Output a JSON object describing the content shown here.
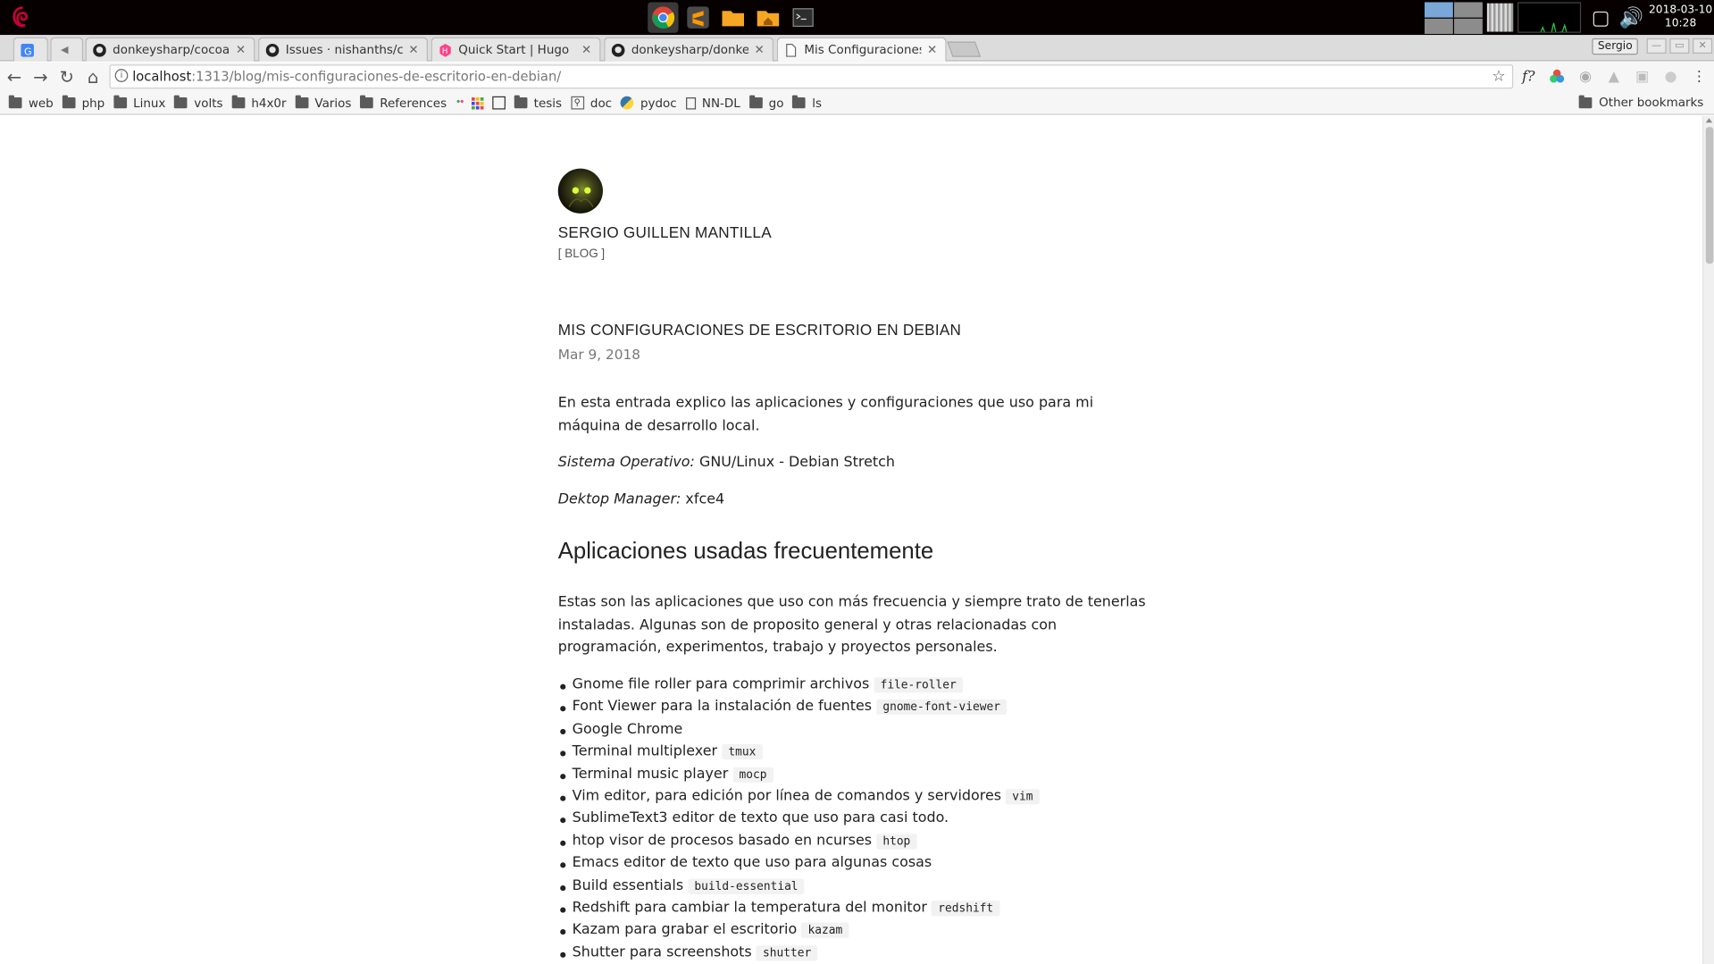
{
  "panel": {
    "clock_date": "2018-03-10",
    "clock_time": "10:28"
  },
  "tabs": [
    {
      "title": "",
      "icon": "google-translate-icon"
    },
    {
      "title": "",
      "icon": "audio-icon"
    },
    {
      "title": "donkeysharp/cocoa-",
      "icon": "github-icon"
    },
    {
      "title": "Issues · nishanths/c",
      "icon": "github-icon"
    },
    {
      "title": "Quick Start | Hugo",
      "icon": "hugo-icon"
    },
    {
      "title": "donkeysharp/donke",
      "icon": "github-icon"
    },
    {
      "title": "Mis Configuraciones",
      "icon": "page-icon"
    }
  ],
  "profile_name": "Sergio",
  "address": {
    "host": "localhost",
    "path": ":1313/blog/mis-configuraciones-de-escritorio-en-debian/"
  },
  "bookmarks": [
    {
      "label": "web",
      "icon": "folder-icon"
    },
    {
      "label": "php",
      "icon": "folder-icon"
    },
    {
      "label": "Linux",
      "icon": "folder-icon"
    },
    {
      "label": "volts",
      "icon": "folder-icon"
    },
    {
      "label": "h4x0r",
      "icon": "folder-icon"
    },
    {
      "label": "Varios",
      "icon": "folder-icon"
    },
    {
      "label": "References",
      "icon": "folder-icon"
    },
    {
      "label": "tesis",
      "icon": "folder-icon"
    },
    {
      "label": "doc",
      "icon": "search-doc-icon"
    },
    {
      "label": "pydoc",
      "icon": "python-icon"
    },
    {
      "label": "NN-DL",
      "icon": "page-icon"
    },
    {
      "label": "go",
      "icon": "folder-icon"
    },
    {
      "label": "ls",
      "icon": "folder-icon"
    }
  ],
  "other_bookmarks": "Other bookmarks",
  "blog": {
    "author": "SERGIO GUILLEN MANTILLA",
    "tag": "[ BLOG ]",
    "post_title": "MIS CONFIGURACIONES DE ESCRITORIO EN DEBIAN",
    "post_date": "Mar 9, 2018",
    "intro": "En esta entrada explico las aplicaciones y configuraciones que uso para mi máquina de desarrollo local.",
    "os_label": "Sistema Operativo:",
    "os_value": " GNU/Linux - Debian Stretch",
    "dm_label": "Dektop Manager:",
    "dm_value": " xfce4",
    "section_title": "Aplicaciones usadas frecuentemente",
    "section_intro": "Estas son las aplicaciones que uso con más frecuencia y siempre trato de tenerlas instaladas. Algunas son de proposito general y otras relacionadas con programación, experimentos, trabajo y proyectos personales.",
    "apps": [
      {
        "text": "Gnome file roller para comprimir archivos",
        "code": "file-roller"
      },
      {
        "text": "Font Viewer para la instalación de fuentes",
        "code": "gnome-font-viewer"
      },
      {
        "text": "Google Chrome",
        "code": ""
      },
      {
        "text": "Terminal multiplexer",
        "code": "tmux"
      },
      {
        "text": "Terminal music player",
        "code": "mocp"
      },
      {
        "text": "Vim editor, para edición por línea de comandos y servidores",
        "code": "vim"
      },
      {
        "text": "SublimeText3 editor de texto que uso para casi todo.",
        "code": ""
      },
      {
        "text": "htop visor de procesos basado en ncurses",
        "code": "htop"
      },
      {
        "text": "Emacs editor de texto que uso para algunas cosas",
        "code": ""
      },
      {
        "text": "Build essentials",
        "code": "build-essential"
      },
      {
        "text": "Redshift para cambiar la temperatura del monitor",
        "code": "redshift"
      },
      {
        "text": "Kazam para grabar el escritorio",
        "code": "kazam"
      },
      {
        "text": "Shutter para screenshots",
        "code": "shutter"
      }
    ]
  }
}
